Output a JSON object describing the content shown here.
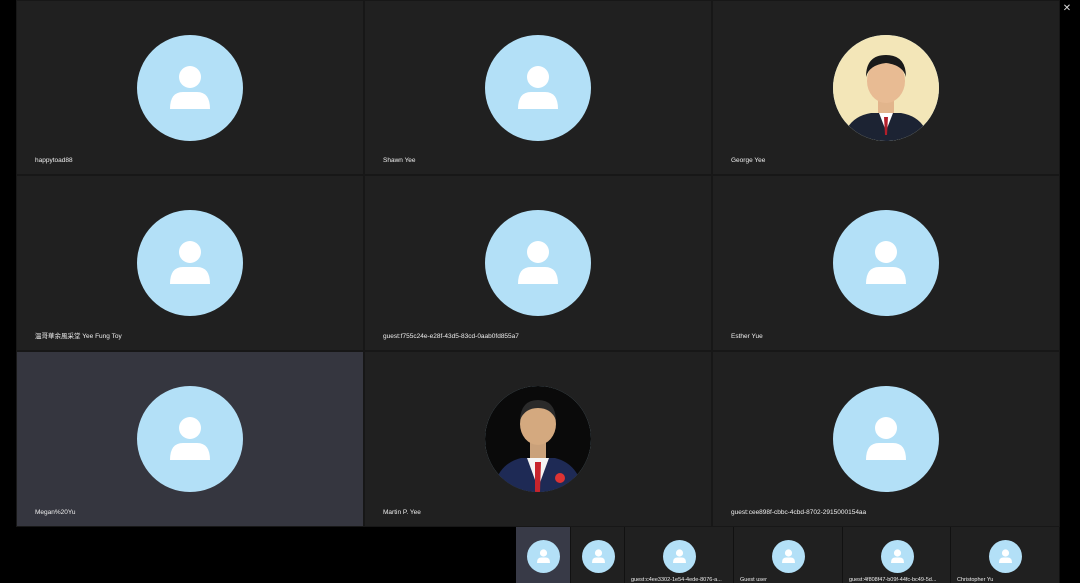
{
  "window": {
    "minimize_icon": "minimize-icon",
    "restore_icon": "restore-icon",
    "close_icon": "close-icon"
  },
  "participants": [
    {
      "name": "happytoad88",
      "avatar": "default-person-icon"
    },
    {
      "name": "Shawn Yee",
      "avatar": "default-person-icon"
    },
    {
      "name": "George Yee",
      "avatar": "photo"
    },
    {
      "name": "溫哥華余風采堂 Yee Fung Toy",
      "avatar": "default-person-icon"
    },
    {
      "name": "guest:f755c24e-e28f-43d5-83cd-0aab0fd855a7",
      "avatar": "default-person-icon"
    },
    {
      "name": "Esther Yue",
      "avatar": "default-person-icon"
    },
    {
      "name": "Megan%20Yu",
      "avatar": "default-person-icon",
      "active": true
    },
    {
      "name": "Martin P. Yee",
      "avatar": "photo"
    },
    {
      "name": "guest:cee898f-cbbc-4cbd-8702-2915000154aa",
      "avatar": "default-person-icon"
    }
  ],
  "strip": [
    {
      "name": "",
      "active": true
    },
    {
      "name": ""
    },
    {
      "name": "guest:c4ee3302-1e54-4ede-8076-a..."
    },
    {
      "name": "Guest user"
    },
    {
      "name": "guest:4f808f47-b09f-44fc-bc49-5d..."
    },
    {
      "name": "Christopher Yu"
    }
  ],
  "colors": {
    "avatar_bg": "#b3e0f7",
    "tile_bg": "#202020",
    "active_tile_bg": "#35363f"
  }
}
